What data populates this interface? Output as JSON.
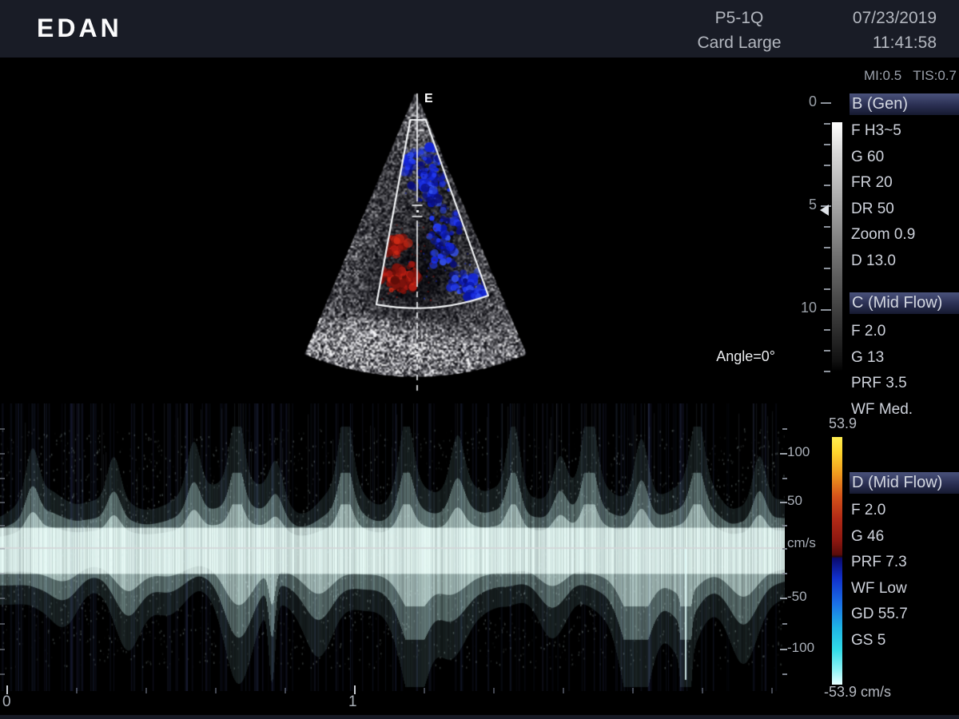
{
  "header": {
    "logo": "EDAN",
    "probe_model": "P5-1Q",
    "preset": "Card Large",
    "date": "07/23/2019",
    "time": "11:41:58"
  },
  "indices": {
    "mi": "MI:0.5",
    "tis": "TIS:0.7"
  },
  "modes": {
    "b": {
      "title": "B (Gen)",
      "params": [
        "F H3~5",
        "G 60",
        "FR 20",
        "DR 50",
        "Zoom 0.9",
        "D 13.0"
      ]
    },
    "c": {
      "title": "C (Mid Flow)",
      "params": [
        "F 2.0",
        "G 13",
        "PRF 3.5",
        "WF Med."
      ]
    },
    "d": {
      "title": "D (Mid Flow)",
      "params": [
        "F 2.0",
        "G 46",
        "PRF 7.3",
        "WF Low",
        "GD 55.7",
        "GS 5"
      ]
    }
  },
  "color_scale": {
    "max_label": "53.9",
    "min_label": "-53.9 cm/s"
  },
  "depth_ruler": {
    "labels": [
      "0",
      "5",
      "10"
    ],
    "depth_cm": 13
  },
  "bmode_overlay": {
    "orientation_mark": "E",
    "angle_label": "Angle=0°"
  },
  "spectral_scale": {
    "labels": [
      "100",
      "50",
      "cm/s",
      "-50",
      "-100"
    ]
  },
  "time_axis": {
    "labels": [
      "0",
      "1"
    ]
  },
  "colors": {
    "header_bg": "#191c26",
    "highlight_top": "#4a527b",
    "highlight_bottom": "#161a30",
    "panel_text": "#ced2db",
    "muted_text": "#9ba1ab",
    "roi_white": "#f4f6f8",
    "doppler_blue": "#1b2bd8",
    "doppler_red": "#a81a12",
    "spectrum_tint": "#dff2ee"
  }
}
